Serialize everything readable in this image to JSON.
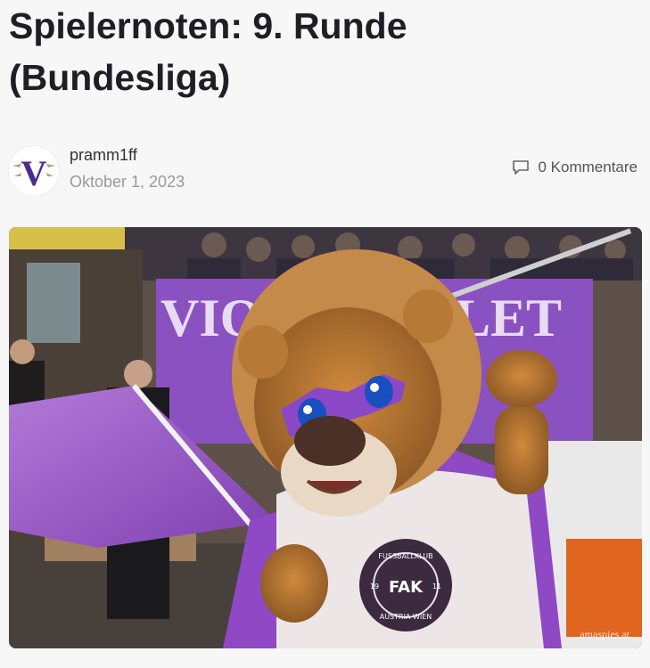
{
  "post": {
    "title_line1": "Spielernoten: 9. Runde",
    "title_line2": "(Bundesliga)",
    "author": "pramm1ff",
    "date": "Oktober 1, 2023",
    "comments_label": "0 Kommentare"
  },
  "avatar": {
    "letter": "V",
    "color": "#4b2d8f"
  },
  "hero": {
    "banner_left": "VIO",
    "banner_right": "LET",
    "jersey_top": "FUSSBALLKLUB",
    "jersey_bottom": "AUSTRIA WIEN",
    "jersey_badge": "FAK",
    "jersey_num_left": "19",
    "jersey_num_right": "11",
    "watermark": "amaspies.at"
  },
  "colors": {
    "accent_purple": "#9b59c9",
    "title": "#1e1e24",
    "muted": "#9a9a9a"
  }
}
